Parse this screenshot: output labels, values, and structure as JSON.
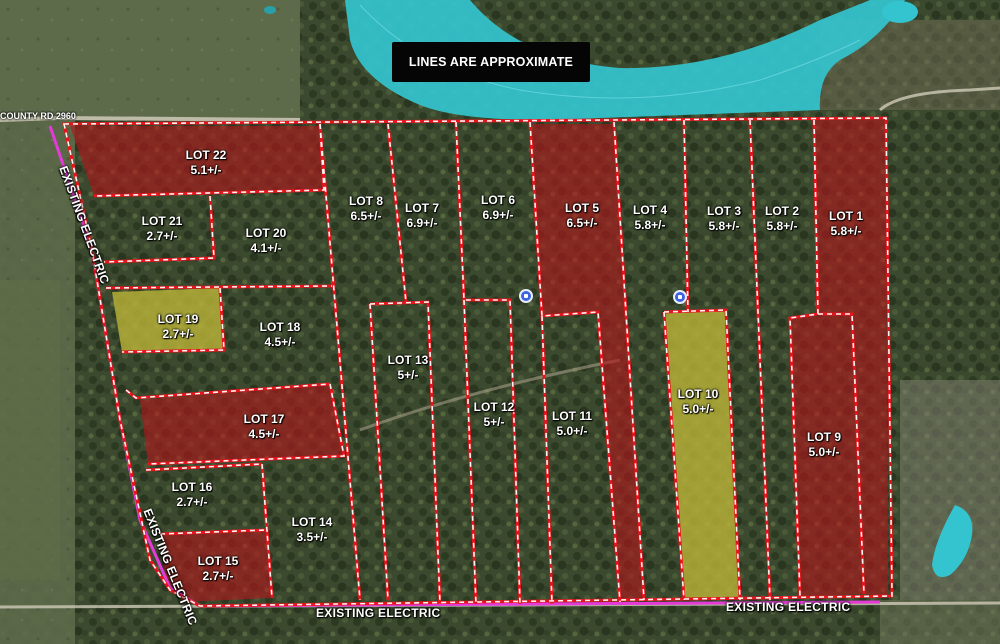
{
  "map": {
    "banner": "LINES ARE APPROXIMATE",
    "road_label": "COUNTY RD 2960",
    "electric": {
      "left": "EXISTING ELECTRIC",
      "lower_left": "EXISTING ELECTRIC",
      "bottom_left": "EXISTING ELECTRIC",
      "bottom_right": "EXISTING ELECTRIC"
    },
    "colors": {
      "boundary": "#e8141c",
      "sold_fill": "#b3171c",
      "pending_fill": "#b8b238",
      "water": "#34c4cf",
      "electric_line": "#e43ad8"
    },
    "icons": [
      "marker-icon",
      "marker-icon"
    ],
    "lots": [
      {
        "id": "lot-22",
        "name": "LOT 22",
        "size": "5.1+/-",
        "status": "sold"
      },
      {
        "id": "lot-21",
        "name": "LOT 21",
        "size": "2.7+/-",
        "status": "available"
      },
      {
        "id": "lot-20",
        "name": "LOT 20",
        "size": "4.1+/-",
        "status": "available"
      },
      {
        "id": "lot-19",
        "name": "LOT 19",
        "size": "2.7+/-",
        "status": "pending"
      },
      {
        "id": "lot-18",
        "name": "LOT 18",
        "size": "4.5+/-",
        "status": "available"
      },
      {
        "id": "lot-17",
        "name": "LOT 17",
        "size": "4.5+/-",
        "status": "sold"
      },
      {
        "id": "lot-16",
        "name": "LOT 16",
        "size": "2.7+/-",
        "status": "available"
      },
      {
        "id": "lot-15",
        "name": "LOT 15",
        "size": "2.7+/-",
        "status": "sold"
      },
      {
        "id": "lot-14",
        "name": "LOT 14",
        "size": "3.5+/-",
        "status": "available"
      },
      {
        "id": "lot-13",
        "name": "LOT 13",
        "size": "5+/-",
        "status": "available"
      },
      {
        "id": "lot-12",
        "name": "LOT 12",
        "size": "5+/-",
        "status": "available"
      },
      {
        "id": "lot-11",
        "name": "LOT 11",
        "size": "5.0+/-",
        "status": "available"
      },
      {
        "id": "lot-10",
        "name": "LOT 10",
        "size": "5.0+/-",
        "status": "pending"
      },
      {
        "id": "lot-9",
        "name": "LOT 9",
        "size": "5.0+/-",
        "status": "sold"
      },
      {
        "id": "lot-8",
        "name": "LOT 8",
        "size": "6.5+/-",
        "status": "available"
      },
      {
        "id": "lot-7",
        "name": "LOT 7",
        "size": "6.9+/-",
        "status": "available"
      },
      {
        "id": "lot-6",
        "name": "LOT 6",
        "size": "6.9+/-",
        "status": "available"
      },
      {
        "id": "lot-5",
        "name": "LOT 5",
        "size": "6.5+/-",
        "status": "sold"
      },
      {
        "id": "lot-4",
        "name": "LOT 4",
        "size": "5.8+/-",
        "status": "available"
      },
      {
        "id": "lot-3",
        "name": "LOT 3",
        "size": "5.8+/-",
        "status": "available"
      },
      {
        "id": "lot-2",
        "name": "LOT 2",
        "size": "5.8+/-",
        "status": "available"
      },
      {
        "id": "lot-1",
        "name": "LOT 1",
        "size": "5.8+/-",
        "status": "sold"
      }
    ]
  }
}
